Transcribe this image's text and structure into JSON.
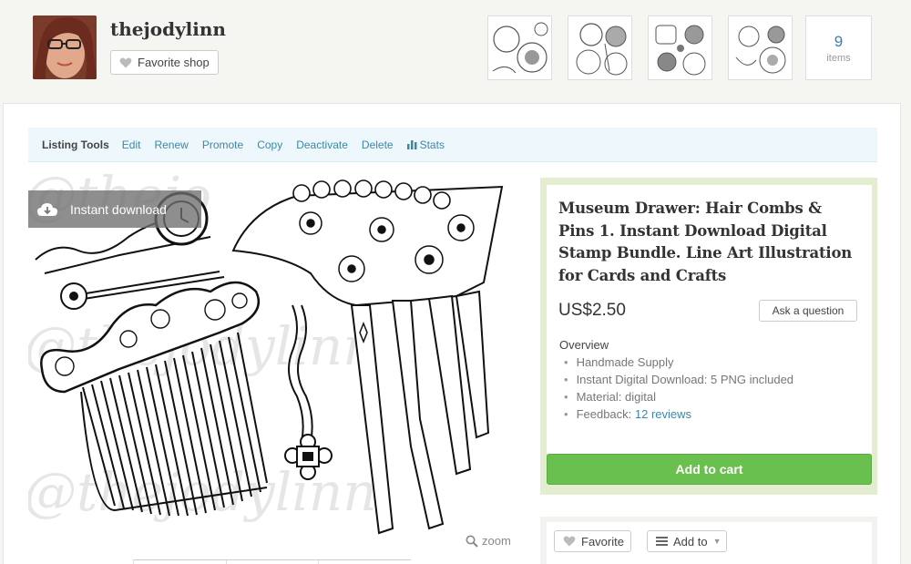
{
  "shop": {
    "name": "thejodylinn",
    "favorite_label": "Favorite shop",
    "items_count": "9",
    "items_label": "items"
  },
  "listing_tools": {
    "title": "Listing Tools",
    "links": [
      "Edit",
      "Renew",
      "Promote",
      "Copy",
      "Deactivate",
      "Delete",
      "Stats"
    ]
  },
  "image": {
    "badge_label": "Instant download",
    "zoom_label": "zoom",
    "watermark": "@thejodylinn"
  },
  "listing": {
    "title": "Museum Drawer: Hair Combs & Pins 1. Instant Download Digital Stamp Bundle. Line Art Illustration for Cards and Crafts",
    "price": "US$2.50",
    "ask_label": "Ask a question",
    "overview_title": "Overview",
    "overview_items": [
      "Handmade Supply",
      "Instant Digital Download: 5 PNG included",
      "Material: digital"
    ],
    "feedback_label": "Feedback:",
    "feedback_link": "12 reviews",
    "add_to_cart_label": "Add to cart"
  },
  "actions": {
    "favorite_label": "Favorite",
    "add_to_label": "Add to"
  },
  "colors": {
    "accent_link": "#3a89a8",
    "add_to_cart": "#6ac04f",
    "buy_box_border": "#e3edcf",
    "tools_bar": "#eef7fb"
  }
}
